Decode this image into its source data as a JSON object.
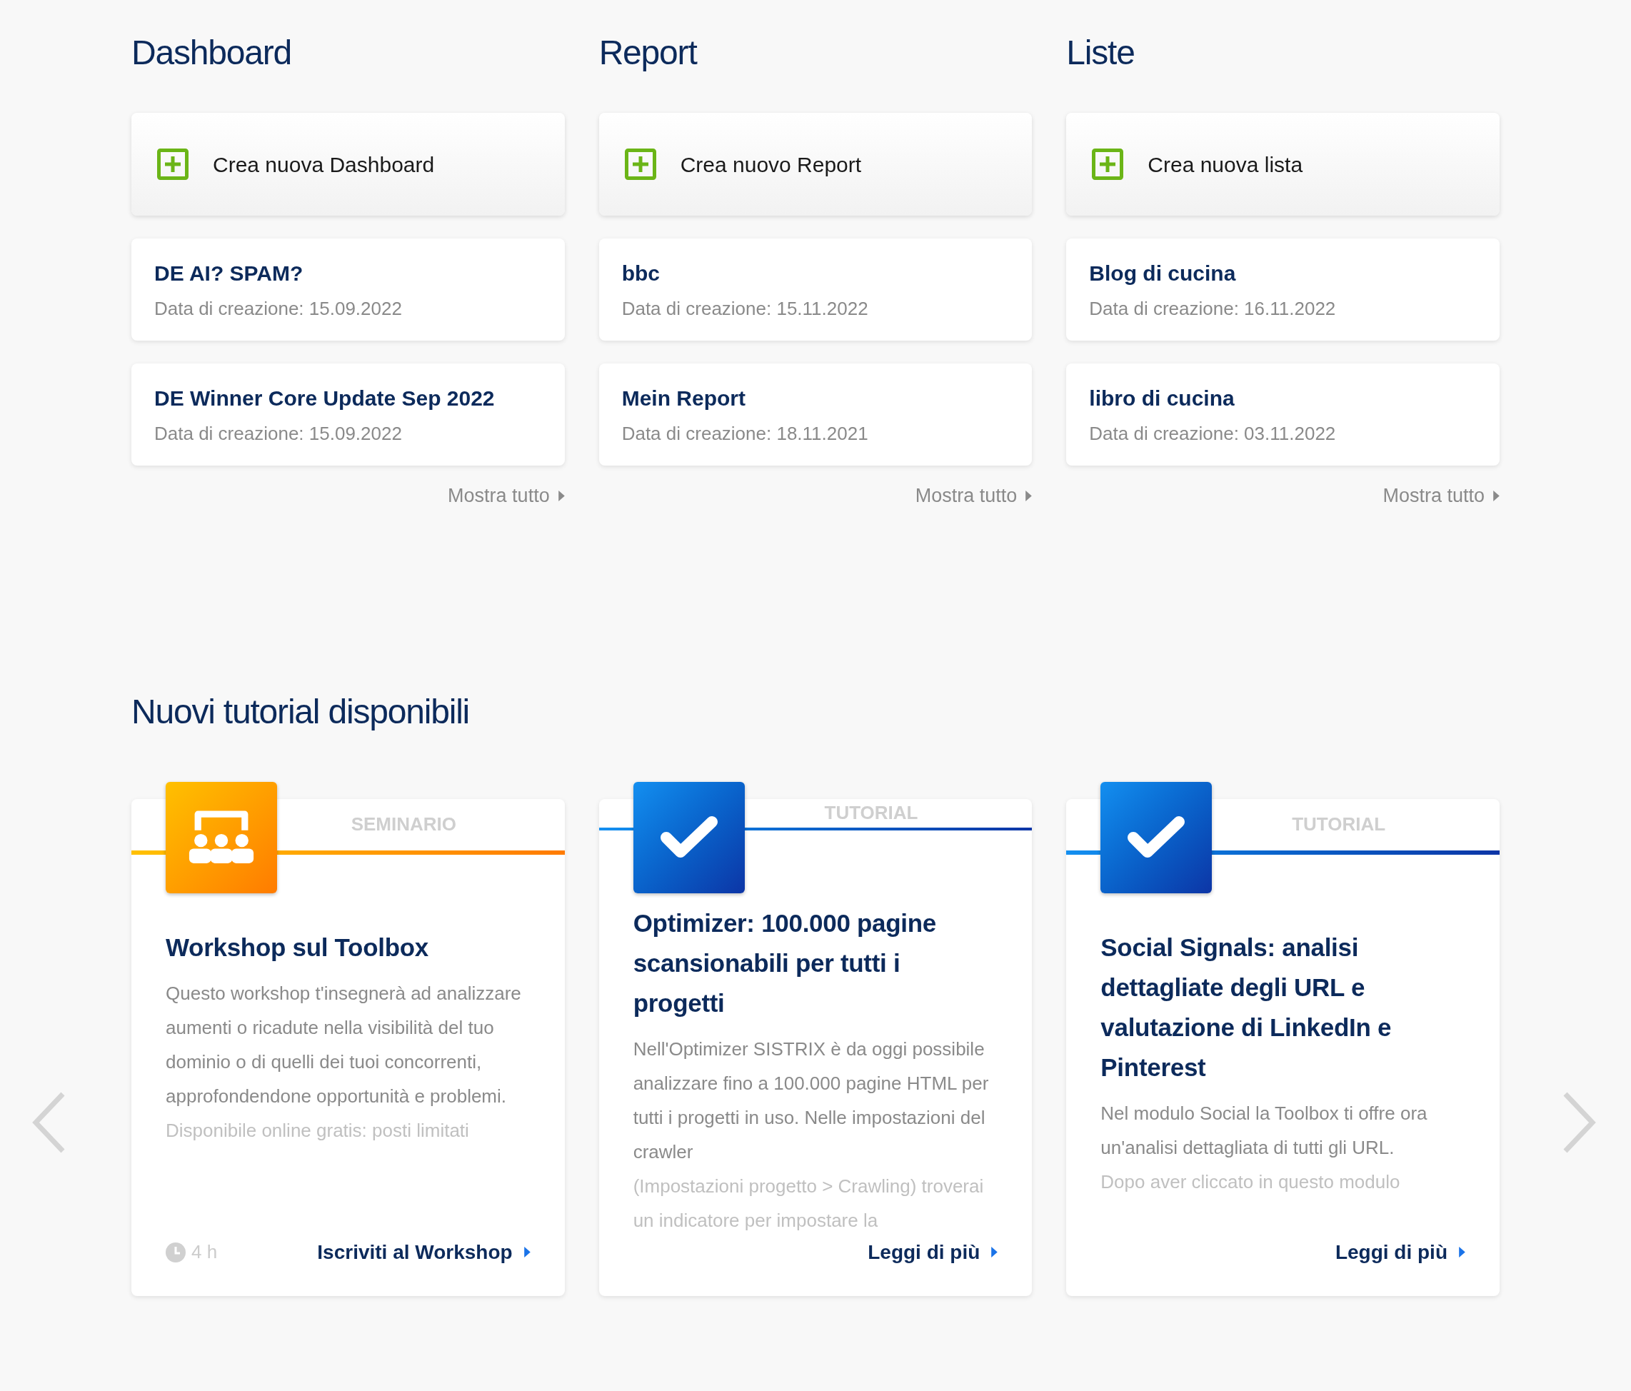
{
  "sections": [
    {
      "title": "Dashboard",
      "create_label": "Crea nuova Dashboard",
      "items": [
        {
          "name": "DE AI? SPAM?",
          "date": "Data di creazione: 15.09.2022"
        },
        {
          "name": "DE Winner Core Update Sep 2022",
          "date": "Data di creazione: 15.09.2022"
        }
      ],
      "show_all": "Mostra tutto"
    },
    {
      "title": "Report",
      "create_label": "Crea nuovo Report",
      "items": [
        {
          "name": "bbc",
          "date": "Data di creazione: 15.11.2022"
        },
        {
          "name": "Mein Report",
          "date": "Data di creazione: 18.11.2021"
        }
      ],
      "show_all": "Mostra tutto"
    },
    {
      "title": "Liste",
      "create_label": "Crea nuova lista",
      "items": [
        {
          "name": "Blog di cucina",
          "date": "Data di creazione: 16.11.2022"
        },
        {
          "name": "libro di cucina",
          "date": "Data di creazione: 03.11.2022"
        }
      ],
      "show_all": "Mostra tutto"
    }
  ],
  "tutorials": {
    "title": "Nuovi tutorial disponibili",
    "cards": [
      {
        "kind": "seminar",
        "category": "SEMINARIO",
        "title": "Workshop sul Toolbox",
        "description": "Questo workshop t'insegnerà ad analizzare aumenti o ricadute nella visibilità del tuo dominio o di quelli dei tuoi concorrenti, approfondendone opportunità e problemi.",
        "description_faded": "Disponibile online gratis: posti limitati",
        "duration": "4 h",
        "link": "Iscriviti al Workshop"
      },
      {
        "kind": "tutorial",
        "category": "TUTORIAL",
        "title": "Optimizer: 100.000 pagine scansionabili per tutti i progetti",
        "description": "Nell'Optimizer SISTRIX è da oggi possibile analizzare fino a 100.000 pagine HTML per tutti i progetti in uso. Nelle impostazioni del crawler",
        "description_faded": "(Impostazioni progetto > Crawling) troverai un indicatore per impostare la",
        "link": "Leggi di più"
      },
      {
        "kind": "tutorial",
        "category": "TUTORIAL",
        "title": "Social Signals: analisi dettagliate degli URL e valutazione di LinkedIn e Pinterest",
        "description": "Nel modulo Social la Toolbox ti offre ora un'analisi dettagliata di tutti gli URL.",
        "description_faded": "Dopo aver cliccato in questo modulo",
        "link": "Leggi di più"
      }
    ]
  }
}
